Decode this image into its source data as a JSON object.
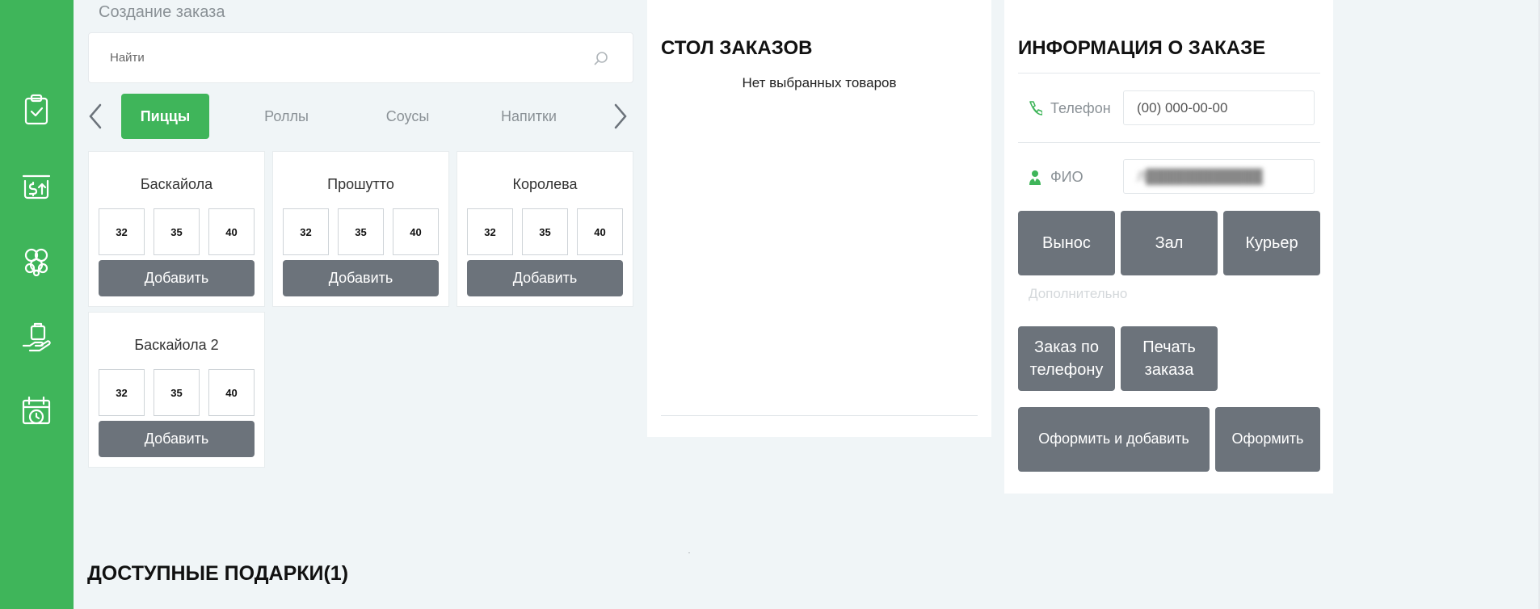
{
  "sidebar": {
    "icons": [
      "clipboard-check-icon",
      "money-transfer-icon",
      "dough-icon",
      "hand-bag-icon",
      "calendar-clock-icon"
    ]
  },
  "breadcrumb": "Создание заказа",
  "search": {
    "placeholder": "Найти"
  },
  "categories": {
    "tabs": [
      "Пиццы",
      "Роллы",
      "Соусы",
      "Напитки"
    ],
    "active": "Пиццы"
  },
  "products": [
    {
      "name": "Баскайола",
      "sizes": [
        "32",
        "35",
        "40"
      ],
      "add_label": "Добавить"
    },
    {
      "name": "Прошутто",
      "sizes": [
        "32",
        "35",
        "40"
      ],
      "add_label": "Добавить"
    },
    {
      "name": "Королева",
      "sizes": [
        "32",
        "35",
        "40"
      ],
      "add_label": "Добавить"
    },
    {
      "name": "Баскайола 2",
      "sizes": [
        "32",
        "35",
        "40"
      ],
      "add_label": "Добавить"
    }
  ],
  "orders_table": {
    "title": "СТОЛ ЗАКАЗОВ",
    "empty_text": "Нет выбранных товаров"
  },
  "order_info": {
    "title": "ИНФОРМАЦИЯ О ЗАКАЗЕ",
    "phone_label": "Телефон",
    "phone_placeholder": "(00) 000-00-00",
    "name_label": "ФИО",
    "name_value": "Л████████████",
    "delivery_buttons": [
      "Вынос",
      "Зал",
      "Курьер"
    ],
    "extra_label": "Дополнительно",
    "phone_order_label": "Заказ по телефону",
    "print_label": "Печать заказа",
    "submit_add_label": "Оформить и добавить",
    "submit_label": "Оформить"
  },
  "gifts": {
    "title": "ДОСТУПНЫЕ ПОДАРКИ(1)"
  },
  "colors": {
    "brand": "#3fb55a",
    "button": "#6c737b",
    "background": "#f0f5f7"
  }
}
